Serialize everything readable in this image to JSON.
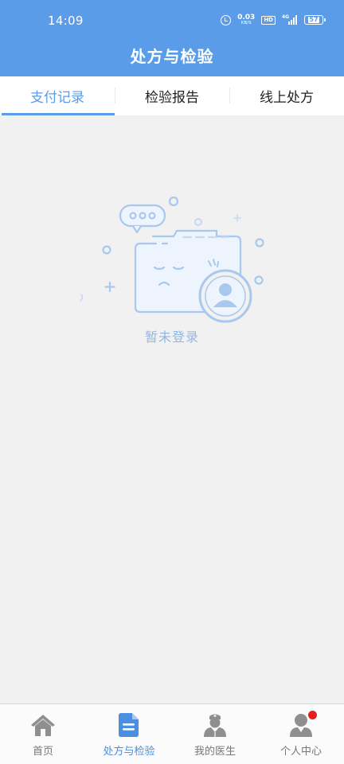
{
  "status_bar": {
    "time": "14:09",
    "net_speed_value": "0.03",
    "net_speed_unit": "KB/S",
    "hd_label": "HD",
    "signal_label": "4G",
    "battery": "57"
  },
  "header": {
    "title": "处方与检验"
  },
  "tabs": [
    {
      "label": "支付记录",
      "active": true
    },
    {
      "label": "检验报告",
      "active": false
    },
    {
      "label": "线上处方",
      "active": false
    }
  ],
  "empty_state": {
    "message": "暂未登录"
  },
  "bottom_nav": [
    {
      "label": "首页",
      "icon": "home-icon",
      "active": false
    },
    {
      "label": "处方与检验",
      "icon": "document-icon",
      "active": true
    },
    {
      "label": "我的医生",
      "icon": "doctor-icon",
      "active": false
    },
    {
      "label": "个人中心",
      "icon": "person-icon",
      "active": false,
      "badge_dot": true
    }
  ],
  "colors": {
    "brand": "#5b9ce8",
    "background": "#f1f1f1",
    "badge": "#e81e1e",
    "empty_text": "#93b7e3"
  }
}
